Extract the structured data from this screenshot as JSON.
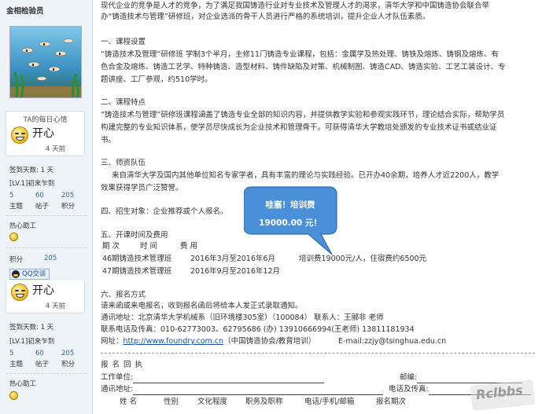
{
  "sidebar": {
    "username": "金相检验员",
    "mood_title": "TA的每日心情",
    "mood_text": "开心",
    "mood_time": "4 天前",
    "signin_days": "签到天数: 1 天",
    "level": "[LV.1]初来乍到",
    "stats": [
      {
        "num": "5",
        "label": "主题"
      },
      {
        "num": "60",
        "label": "帖子"
      },
      {
        "num": "205",
        "label": "积分"
      }
    ],
    "hot_label": "热心助工",
    "points_label": "积分",
    "points_value": "205",
    "qq_label": "QQ交谈",
    "dup_mood_text": "开心",
    "dup_mood_time": "4 天前",
    "dup_signin_days": "签到天数: 1 天",
    "dup_level": "[LV.1]初来乍到",
    "dup_stats": [
      {
        "num": "5",
        "label": "主题"
      },
      {
        "num": "60",
        "label": "帖子"
      },
      {
        "num": "205",
        "label": "积分"
      }
    ],
    "dup_hot_label": "热心助工"
  },
  "content": {
    "intro_line1": "现代企业的竞争是人才的竞争，为了满足我国铸造行业对专业技术及管理人才的渴求，清华大学和中国铸造协会联合举",
    "intro_line2": "办“铸造技术与管理”研修班，对企业选派的骨干人员进行严格的系统培训，提升企业人才队伍素质。",
    "s1_title": "一、课程设置",
    "s1_line1": "“铸造技术及管理”研修班  学制3个半月，主修11门铸造专业课程，包括：金属学及热处理、铸铁及熔炼、铸钢及熔炼、有",
    "s1_line2": "色合金及熔炼、铸造工艺学、特种铸造、造型材料、铸件缺陷及对策、机械制图、铸造CAD、铸造实验、工艺工装设计、专",
    "s1_line3": "题讲座、工厂参观，约510学时。",
    "s2_title": "二、课程特点",
    "s2_line1": "“铸造技术与管理”研修班课程涵盖了铸造专业全部的知识内容，并提供教学实验和参观实践环节，理论结合实际，帮助学员",
    "s2_line2": "构建完整的专业知识体系，使学员尽快成长为企业技术和管理骨干。可获得清华大学教培处颁发的专业技术证书或结业证",
    "s2_line3": "书。",
    "s3_title": "三、师资队伍",
    "s3_line1": "来自清华大学及国内其他单位知名专家学者，具有丰富的理论与实践经验。已开办40余期，培养人才近2200人，教学",
    "s3_line2": "效果获得学员广泛赞誉。",
    "s4_title": "四、招生对象：企业推荐或个人报名。",
    "s5_title": "五、开课时间及费用",
    "s5_headers": [
      "期  次",
      "时     间",
      "费  用"
    ],
    "s5_rows": [
      {
        "name": "46期铸造技术管理班",
        "time": "2016年3月至2016年6月",
        "fee": "培训费19000元/人，住宿费约6500元"
      },
      {
        "name": "47期铸造技术管理班",
        "time": "2016年9月至2016年12月",
        "fee": ""
      }
    ],
    "s6_title": "六、报名方式",
    "s6_line1": "请来函或来电报名，收到报名函后将给本人发正式录取通知。",
    "s6_addr": "通讯地址：北京清华大学机械系（旧环境楼305室）（100084）   联系人：王郦非 老师",
    "s6_phone": "联系电话及传真：010-62773003、62795686 (办)    13910666994(王老师)    13811181934",
    "s6_web_prefix": "网址：",
    "s6_web_link": "http://www.foundry.com.cn",
    "s6_web_suffix": "（中国铸造协会/教育培训）",
    "s6_email": "E-mail:zzjy@tsinghua.edu.cn",
    "form_title": "报 名 回 执",
    "form_unit": "工作单位:",
    "form_zip": "邮编:",
    "form_addr": "通讯地址:",
    "form_tel": "电话及传真:",
    "form_cols": [
      "姓  名",
      "性别",
      "文化程度",
      "职务及职称",
      "电话/手机/邮箱",
      "报名期次"
    ]
  },
  "bubble": {
    "line1": "哇塞！培训费",
    "line2": "19000.00 元！",
    "fill_color": "#4a90d9",
    "border_color": "#2e6db4"
  },
  "watermark": {
    "text": "Rclbbs"
  }
}
